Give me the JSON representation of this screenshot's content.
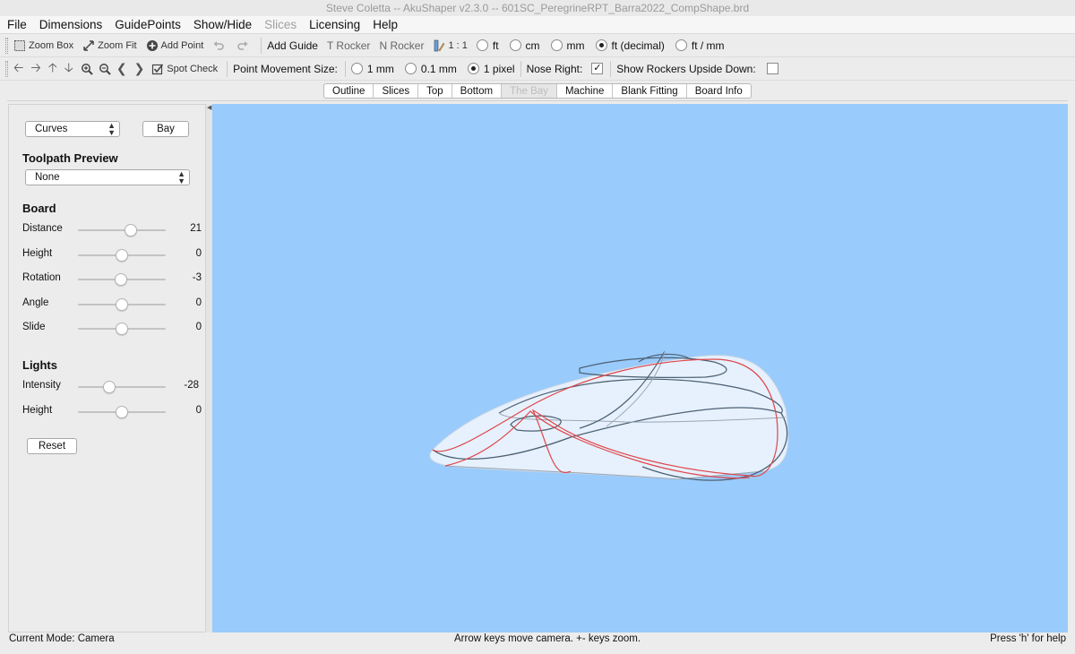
{
  "window": {
    "title": "Steve Coletta -- AkuShaper v2.3.0  --  601SC_PeregrineRPT_Barra2022_CompShape.brd"
  },
  "menu": {
    "items": [
      {
        "label": "File",
        "disabled": false
      },
      {
        "label": "Dimensions",
        "disabled": false
      },
      {
        "label": "GuidePoints",
        "disabled": false
      },
      {
        "label": "Show/Hide",
        "disabled": false
      },
      {
        "label": "Slices",
        "disabled": true
      },
      {
        "label": "Licensing",
        "disabled": false
      },
      {
        "label": "Help",
        "disabled": false
      }
    ]
  },
  "toolbar1": {
    "zoom_box": "Zoom Box",
    "zoom_fit": "Zoom Fit",
    "add_point": "Add Point",
    "add_guide": "Add Guide",
    "t_rocker": "T Rocker",
    "n_rocker": "N Rocker",
    "scale": "1 : 1",
    "units": [
      {
        "label": "ft",
        "selected": false
      },
      {
        "label": "cm",
        "selected": false
      },
      {
        "label": "mm",
        "selected": false
      },
      {
        "label": "ft (decimal)",
        "selected": true
      },
      {
        "label": "ft / mm",
        "selected": false
      }
    ]
  },
  "toolbar2": {
    "spot_check": "Spot Check",
    "point_movement_label": "Point Movement Size:",
    "movement_sizes": [
      {
        "label": "1 mm",
        "selected": false
      },
      {
        "label": "0.1 mm",
        "selected": false
      },
      {
        "label": "1 pixel",
        "selected": true
      }
    ],
    "nose_right_label": "Nose Right:",
    "nose_right_checked": true,
    "rockers_upside_down_label": "Show Rockers Upside Down:",
    "rockers_upside_down_checked": false
  },
  "tabs": [
    {
      "label": "Outline",
      "active": false
    },
    {
      "label": "Slices",
      "active": false
    },
    {
      "label": "Top",
      "active": false
    },
    {
      "label": "Bottom",
      "active": false
    },
    {
      "label": "The Bay",
      "active": true
    },
    {
      "label": "Machine",
      "active": false
    },
    {
      "label": "Blank Fitting",
      "active": false
    },
    {
      "label": "Board Info",
      "active": false
    }
  ],
  "panel": {
    "view_select": "Curves",
    "bay_button": "Bay",
    "toolpath_heading": "Toolpath Preview",
    "toolpath_select": "None",
    "board_heading": "Board",
    "board_sliders": [
      {
        "label": "Distance",
        "value": "21",
        "pos": 0.6
      },
      {
        "label": "Height",
        "value": "0",
        "pos": 0.5
      },
      {
        "label": "Rotation",
        "value": "-3",
        "pos": 0.49
      },
      {
        "label": "Angle",
        "value": "0",
        "pos": 0.5
      },
      {
        "label": "Slide",
        "value": "0",
        "pos": 0.5
      }
    ],
    "lights_heading": "Lights",
    "light_sliders": [
      {
        "label": "Intensity",
        "value": "-28",
        "pos": 0.36
      },
      {
        "label": "Height",
        "value": "0",
        "pos": 0.5
      }
    ],
    "reset_button": "Reset"
  },
  "status": {
    "mode": "Current Mode: Camera",
    "hint": "Arrow keys move camera. +- keys zoom.",
    "help": "Press 'h' for help"
  },
  "colors": {
    "viewport_bg": "#99cbfc",
    "curve_red": "#e0464a",
    "curve_dark": "#4d6072"
  }
}
